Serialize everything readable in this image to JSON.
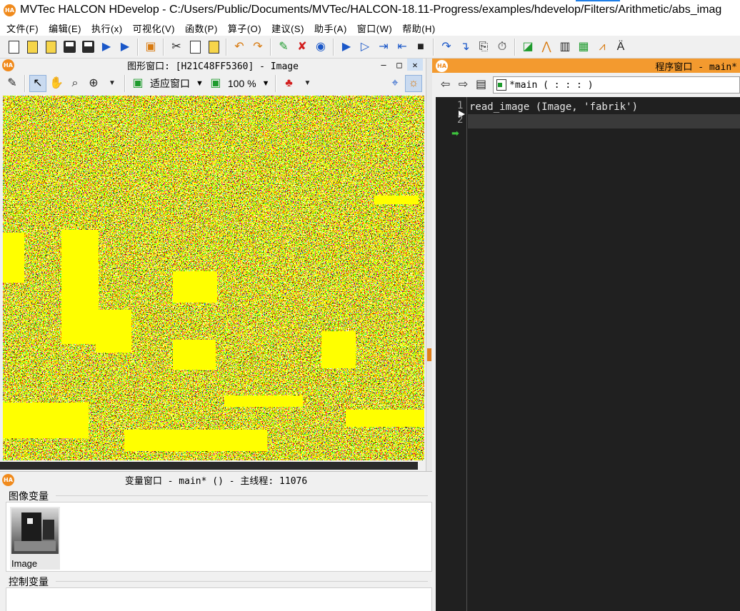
{
  "app": {
    "title": "MVTec HALCON HDevelop - C:/Users/Public/Documents/MVTec/HALCON-18.11-Progress/examples/hdevelop/Filters/Arithmetic/abs_imag",
    "logo_text": "HA"
  },
  "menu": [
    {
      "label": "文件(F)"
    },
    {
      "label": "编辑(E)"
    },
    {
      "label": "执行(x)"
    },
    {
      "label": "可视化(V)"
    },
    {
      "label": "函数(P)"
    },
    {
      "label": "算子(O)"
    },
    {
      "label": "建议(S)"
    },
    {
      "label": "助手(A)"
    },
    {
      "label": "窗口(W)"
    },
    {
      "label": "帮助(H)"
    }
  ],
  "graphics_window": {
    "title": "图形窗口: [H21C48FF5360] - Image",
    "fit_mode": "适应窗口",
    "zoom": "100 %"
  },
  "program_window": {
    "title": "程序窗口 - main*",
    "procedure": "*main ( : : : )",
    "lines": [
      {
        "number": "1",
        "code": "read_image (Image, 'fabrik')"
      },
      {
        "number": "2",
        "code": ""
      }
    ]
  },
  "variable_window": {
    "title": "变量窗口 - main* () - 主线程: 11076",
    "image_vars_label": "图像变量",
    "control_vars_label": "控制变量",
    "image_vars": [
      {
        "name": "Image"
      }
    ]
  },
  "colors": {
    "halcon_orange": "#f39a2f",
    "editor_bg": "#202020",
    "image_yellow": "#ffff00"
  }
}
